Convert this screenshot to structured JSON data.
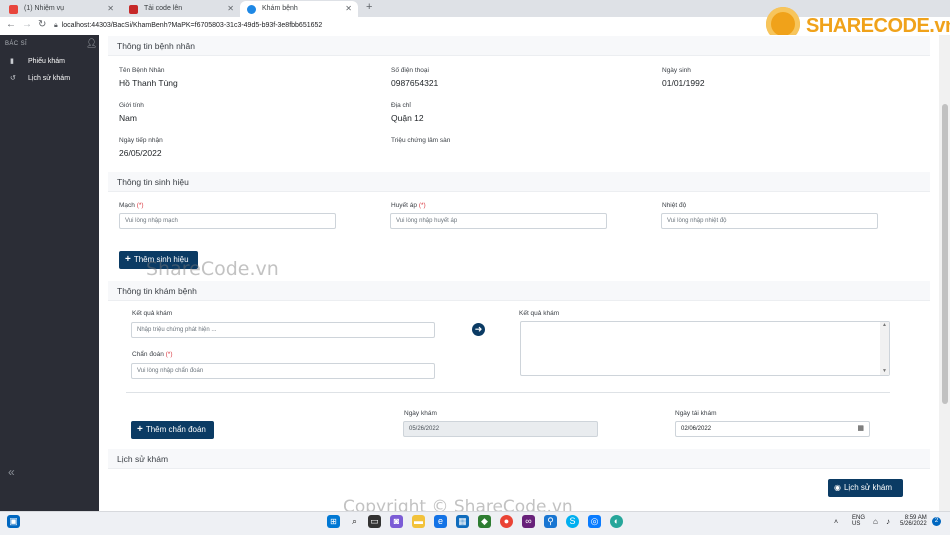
{
  "browser": {
    "tabs": [
      {
        "title": "(1) Nhiệm vụ",
        "active": false
      },
      {
        "title": "Tải code lên",
        "active": false
      },
      {
        "title": "Khám bệnh",
        "active": true
      }
    ],
    "new_tab": "+",
    "url": "localhost:44303/BacSi/KhamBenh?MaPK=f6705803-31c3-49d5-b93f-3e8fbb651652"
  },
  "logo": {
    "text": "SHARECODE.vn"
  },
  "sidebar": {
    "header": "BÁC SĨ",
    "items": [
      {
        "label": "Phiếu khám",
        "icon": "clipboard-icon"
      },
      {
        "label": "Lịch sử khám",
        "icon": "history-icon"
      }
    ],
    "collapse_glyph": "«"
  },
  "patient": {
    "title": "Thông tin bệnh nhân",
    "name_label": "Tên Bệnh Nhân",
    "name": "Hồ Thanh Tùng",
    "phone_label": "Số điện thoại",
    "phone": "0987654321",
    "dob_label": "Ngày sinh",
    "dob": "01/01/1992",
    "gender_label": "Giới tính",
    "gender": "Nam",
    "address_label": "Địa chỉ",
    "address": "Quận 12",
    "intake_label": "Ngày tiếp nhận",
    "intake": "26/05/2022",
    "symptom_label": "Triệu chứng lâm sàn",
    "symptom": ""
  },
  "vitals": {
    "title": "Thông tin sinh hiệu",
    "required_mark": "(*)",
    "pulse_label": "Mạch",
    "pulse_placeholder": "Vui lòng nhập mạch",
    "bp_label": "Huyết áp",
    "bp_placeholder": "Vui lòng nhập huyết áp",
    "temp_label": "Nhiệt độ",
    "temp_placeholder": "Vui lòng nhập nhiệt độ",
    "add_button": "Thêm sinh hiệu"
  },
  "exam": {
    "title": "Thông tin khám bệnh",
    "result_label": "Kết quả khám",
    "result_placeholder": "Nhập triệu chứng phát hiện ...",
    "result_box_label": "Kết quả khám",
    "diagnosis_label": "Chẩn đoán",
    "diagnosis_placeholder": "Vui lòng nhập chẩn đoán",
    "add_diagnosis_button": "Thêm chẩn đoán",
    "exam_date_label": "Ngày khám",
    "exam_date": "05/26/2022",
    "revisit_label": "Ngày tái khám",
    "revisit_date": "02/06/2022"
  },
  "history": {
    "title": "Lịch sử khám",
    "button": "Lịch sử khám"
  },
  "watermarks": {
    "center": "ShareCode.vn",
    "bottom": "Copyright © ShareCode.vn"
  },
  "taskbar": {
    "lang": "ENG",
    "region": "US",
    "time": "8:59 AM",
    "date": "5/26/2022",
    "notif_count": "2"
  },
  "colors": {
    "primary": "#0b3b64",
    "required": "#d9363e",
    "sidebar": "#2b2d36",
    "logo": "#f0a21a"
  }
}
